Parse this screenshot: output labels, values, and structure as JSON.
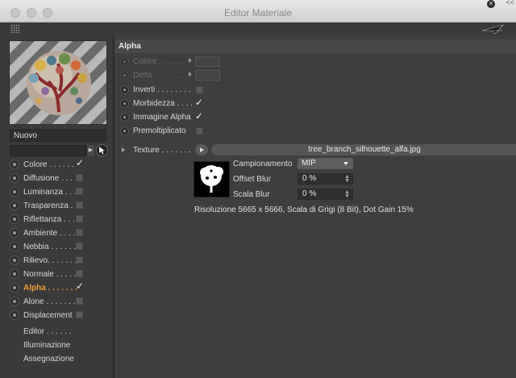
{
  "window": {
    "title": "Editor Materiale",
    "corner_close": "✕",
    "corner_arrows": "<<"
  },
  "material": {
    "name": "Nuovo"
  },
  "channels": [
    {
      "label": "Colore . . . . . .",
      "state": "check",
      "active": false
    },
    {
      "label": "Diffusione . . .",
      "state": "box",
      "active": false
    },
    {
      "label": "Luminanza . . .",
      "state": "box",
      "active": false
    },
    {
      "label": "Trasparenza . .",
      "state": "box",
      "active": false
    },
    {
      "label": "Riflettanza . . .",
      "state": "box",
      "active": false
    },
    {
      "label": "Ambiente . . . .",
      "state": "box",
      "active": false
    },
    {
      "label": "Nebbia . . . . . .",
      "state": "box",
      "active": false
    },
    {
      "label": "Rilievo. . . . . . .",
      "state": "box",
      "active": false
    },
    {
      "label": "Normale . . . . .",
      "state": "box",
      "active": false
    },
    {
      "label": "Alpha . . . . . . .",
      "state": "check",
      "active": true
    },
    {
      "label": "Alone . . . . . . .",
      "state": "box",
      "active": false
    },
    {
      "label": "Displacement",
      "state": "box",
      "active": false
    }
  ],
  "extra_items": [
    "Editor . . . . . .",
    "Illuminazione",
    "Assegnazione"
  ],
  "section": {
    "title": "Alpha"
  },
  "alpha_props": [
    {
      "label": "Colore . . . . . .",
      "type": "swatch",
      "dim": true
    },
    {
      "label": "Delta . . . . . . .",
      "type": "swatch",
      "dim": true
    },
    {
      "label": "Inverti . . . . . . . .",
      "type": "box",
      "dim": false
    },
    {
      "label": "Morbidezza . . . .",
      "type": "check",
      "dim": false
    },
    {
      "label": "Immagine Alpha",
      "type": "check",
      "dim": false
    },
    {
      "label": "Premoltiplicato",
      "type": "box",
      "dim": false
    }
  ],
  "texture": {
    "label": "Texture . . . . . . .",
    "filename": "tree_branch_silhouette_alfa.jpg",
    "sampling_label": "Campionamento",
    "sampling_value": "MIP",
    "offset_blur_label": "Offset Blur",
    "offset_blur_value": "0 %",
    "scale_blur_label": "Scala Blur",
    "scale_blur_value": "0 %",
    "info": "Risoluzione 5665 x 5666, Scala di Grigi (8 Bit), Dot Gain 15%"
  },
  "glyphs": {
    "check": "✓",
    "spin": "▲▼",
    "dropdown_arrow": "▾"
  },
  "icons": [
    "grip-icon",
    "pointer-icon",
    "picker-icon",
    "play-icon",
    "tree-silhouette-icon"
  ]
}
